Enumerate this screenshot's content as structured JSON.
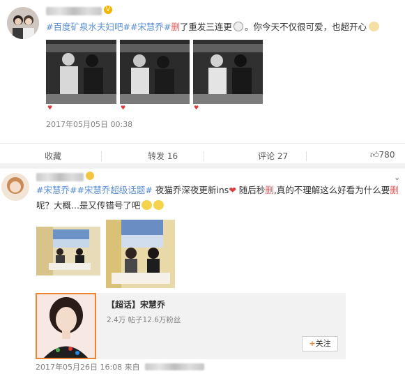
{
  "post1": {
    "text": {
      "tag1": "#百度矿泉水夫妇吧#",
      "tag2": "#宋慧乔#",
      "del": "删",
      "rest1": "了重发三连更",
      "rest2": "。你今天不仅很可爱，也超开心"
    },
    "timestamp": "2017年05月05日 00:38"
  },
  "actions": {
    "collect": "收藏",
    "repost": "转发 16",
    "comment": "评论 27",
    "like": "780"
  },
  "post2": {
    "text": {
      "tag1": "#宋慧乔#",
      "tag2": "#宋慧乔超级话题#",
      "part1": "夜猫乔深夜更新ins",
      "part2": "随后秒",
      "del1": "删",
      "part3": ",真的不理解这么好看为什么要",
      "del2": "删",
      "line2": "呢？大概...是又传错号了吧"
    },
    "card": {
      "title": "【超话】宋慧乔",
      "stats": "2.4万 帖子12.6万粉丝",
      "follow_label": "关注"
    },
    "timestamp": "2017年05月26日 16:08 来自"
  },
  "colors": {
    "tag": "#5b8fd4",
    "deleted_word": "#e8595b",
    "heart": "#e03b3b"
  }
}
